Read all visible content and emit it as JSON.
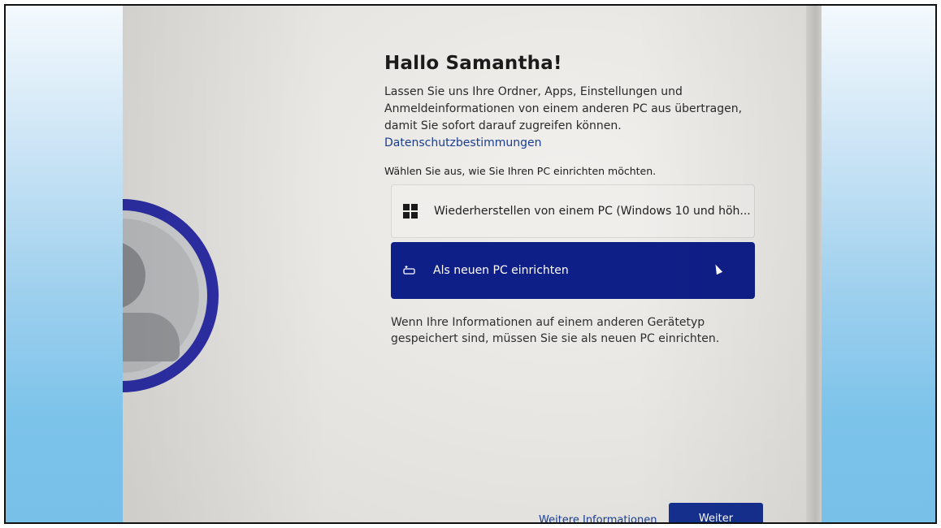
{
  "oobe": {
    "title": "Hallo Samantha!",
    "description": "Lassen Sie uns Ihre Ordner, Apps, Einstellungen und Anmeldeinformationen von einem anderen PC aus übertragen, damit Sie sofort darauf zugreifen können.",
    "privacy_link": "Datenschutzbestimmungen",
    "prompt": "Wählen Sie aus, wie Sie Ihren PC einrichten möchten.",
    "options": [
      {
        "label": "Wiederherstellen von einem PC (Windows 10 und höh...",
        "icon": "windows-logo-icon",
        "selected": false
      },
      {
        "label": "Als neuen PC einrichten",
        "icon": "new-pc-icon",
        "selected": true
      }
    ],
    "info_text": "Wenn Ihre Informationen auf einem anderen Gerätetyp gespeichert sind, müssen Sie sie als neuen PC einrichten.",
    "more_info_link": "Weitere Informationen",
    "next_button": "Weiter"
  },
  "colors": {
    "selected_option": "#0f1f88",
    "primary_button": "#15308e",
    "link": "#1a3d8f",
    "avatar_ring": "#2d2fa6"
  }
}
